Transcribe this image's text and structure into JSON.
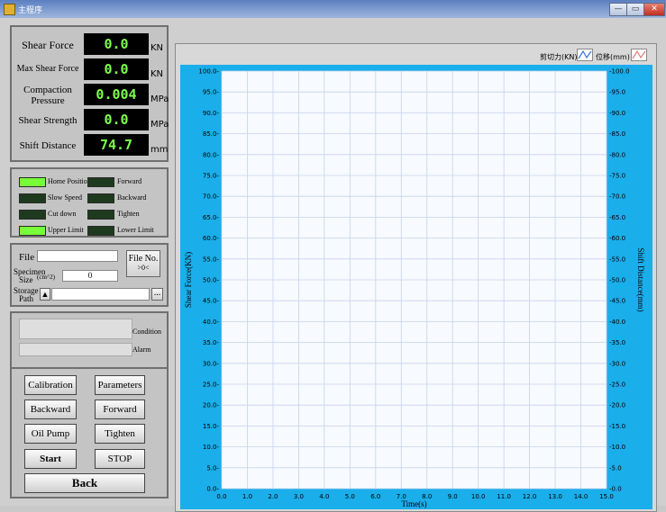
{
  "window": {
    "title": "主程序",
    "btn_min": "—",
    "btn_max": "▭",
    "btn_close": "✕"
  },
  "measurements": {
    "shear_force": {
      "label": "Shear Force",
      "value": "0.0",
      "unit": "KN"
    },
    "max_shear_force": {
      "label": "Max Shear Force",
      "value": "0.0",
      "unit": "KN"
    },
    "compaction_pressure": {
      "label_line1": "Compaction",
      "label_line2": "Pressure",
      "value": "0.004",
      "unit": "MPa"
    },
    "shear_strength": {
      "label": "Shear Strength",
      "value": "0.0",
      "unit": "MPa"
    },
    "shift_distance": {
      "label": "Shift Distance",
      "value": "74.7",
      "unit": "mm"
    }
  },
  "indicators": [
    {
      "label": "Home Position",
      "on": true
    },
    {
      "label": "Forward",
      "on": false
    },
    {
      "label": "Slow Speed",
      "on": false
    },
    {
      "label": "Backward",
      "on": false
    },
    {
      "label": "Cut down",
      "on": false
    },
    {
      "label": "Tighten",
      "on": false
    },
    {
      "label": "Upper Limit",
      "on": true
    },
    {
      "label": "Lower Limit",
      "on": false
    }
  ],
  "file": {
    "label": "File",
    "value": "",
    "specimen_label_1": "Specimen",
    "specimen_label_2": "Size",
    "specimen_unit": "(cm^2)",
    "specimen_value": "0",
    "storage_label_1": "Storage",
    "storage_label_2": "Path",
    "storage_value": "",
    "browse": "...",
    "fileno_label": "File No.",
    "fileno_value": ">0<"
  },
  "status": {
    "condition_label": "Condition",
    "condition_value": "",
    "alarm_label": "Alarm",
    "alarm_value": ""
  },
  "buttons": {
    "calibration": "Calibration",
    "parameters": "Parameters",
    "backward": "Backward",
    "forward": "Forward",
    "oil_pump": "Oil Pump",
    "tighten": "Tighten",
    "start": "Start",
    "stop": "STOP",
    "back": "Back"
  },
  "colors": {
    "lcd_text": "#7cff4c",
    "led_on": "#78ff3a",
    "led_off": "#1e3a1e",
    "chart_frame": "#1aaeea",
    "plot_bg": "#f7fafe",
    "grid": "#c8d2ee"
  },
  "chart_data": {
    "type": "line",
    "xlabel": "Time(s)",
    "ylabel_left": "Shear Force(KN)",
    "ylabel_right": "Shift Distance(mm)",
    "xlim": [
      0,
      15
    ],
    "ylim_left": [
      0,
      100
    ],
    "ylim_right": [
      0,
      100
    ],
    "x_ticks": [
      "0.0",
      "1.0",
      "2.0",
      "3.0",
      "4.0",
      "5.0",
      "6.0",
      "7.0",
      "8.0",
      "9.0",
      "10.0",
      "11.0",
      "12.0",
      "13.0",
      "14.0",
      "15.0"
    ],
    "y_ticks": [
      "0.0",
      "5.0",
      "10.0",
      "15.0",
      "20.0",
      "25.0",
      "30.0",
      "35.0",
      "40.0",
      "45.0",
      "50.0",
      "55.0",
      "60.0",
      "65.0",
      "70.0",
      "75.0",
      "80.0",
      "85.0",
      "90.0",
      "95.0",
      "100.0"
    ],
    "grid": true,
    "legend_position": "top-right",
    "series": [
      {
        "name": "剪切力(KN)",
        "color": "#3a6fd8",
        "values": []
      },
      {
        "name": "位移(mm)",
        "color": "#e07a7a",
        "values": []
      }
    ]
  }
}
